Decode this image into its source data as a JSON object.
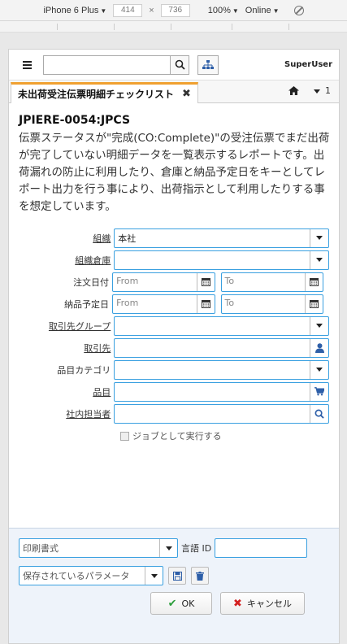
{
  "devtools": {
    "device": "iPhone 6 Plus",
    "width": "414",
    "height": "736",
    "zoom": "100%",
    "network": "Online"
  },
  "header": {
    "search_placeholder": "",
    "user": "SuperUser"
  },
  "tab": {
    "label": "未出荷受注伝票明細チェックリスト",
    "counter": "1"
  },
  "report": {
    "title": "JPIERE-0054:JPCS",
    "description": "伝票ステータスが\"完成(CO:Complete)\"の受注伝票でまだ出荷が完了していない明細データを一覧表示するレポートです。出荷漏れの防止に利用したり、倉庫と納品予定日をキーとしてレポート出力を行う事により、出荷指示として利用したりする事を想定しています。"
  },
  "fields": {
    "org": {
      "label": "組織",
      "value": "本社"
    },
    "org_warehouse": {
      "label": "組織倉庫",
      "value": ""
    },
    "order_date": {
      "label": "注文日付",
      "from": "From",
      "to": "To"
    },
    "promised_date": {
      "label": "納品予定日",
      "from": "From",
      "to": "To"
    },
    "bp_group": {
      "label": "取引先グループ",
      "value": ""
    },
    "bpartner": {
      "label": "取引先",
      "value": ""
    },
    "product_category": {
      "label": "品目カテゴリ",
      "value": ""
    },
    "product": {
      "label": "品目",
      "value": ""
    },
    "sales_rep": {
      "label": "社内担当者",
      "value": ""
    },
    "run_as_job": "ジョブとして実行する"
  },
  "footer": {
    "print_format_placeholder": "印刷書式",
    "language_label": "言語 ID",
    "saved_params_placeholder": "保存されているパラメータ",
    "ok": "OK",
    "cancel": "キャンセル"
  }
}
